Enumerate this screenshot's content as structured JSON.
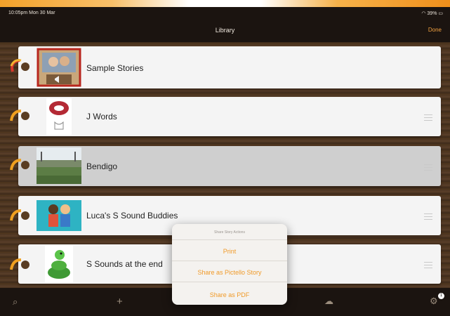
{
  "status": {
    "time": "10:05pm  Mon 30 Mar",
    "battery": "39%"
  },
  "nav": {
    "title": "Library",
    "done_label": "Done"
  },
  "stories": [
    {
      "title": "Sample Stories",
      "selected": false
    },
    {
      "title": "J Words",
      "selected": false
    },
    {
      "title": "Bendigo",
      "selected": true
    },
    {
      "title": "Luca's S Sound Buddies",
      "selected": false
    },
    {
      "title": "S Sounds at the end",
      "selected": false
    }
  ],
  "popup": {
    "header": "Share Story Actions",
    "items": [
      "Print",
      "Share as Pictello Story",
      "Share as PDF"
    ]
  },
  "toolbar": {
    "icons": [
      "search-icon",
      "add-icon",
      "cloud-upload-icon",
      "settings-icon"
    ],
    "badge": "1"
  },
  "colors": {
    "accent": "#f09a28",
    "background": "#3a2a1c",
    "row": "#f4f4f4",
    "row_selected": "#cfcfcf"
  }
}
